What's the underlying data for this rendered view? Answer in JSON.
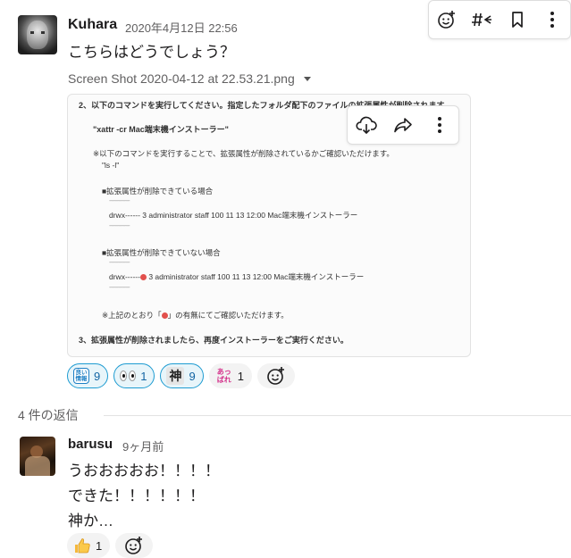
{
  "message": {
    "author": "Kuhara",
    "timestamp": "2020年4月12日 22:56",
    "text": "こちらはどうでしょう？",
    "file_name": "Screen Shot 2020-04-12 at 22.53.21.png",
    "attachment": {
      "step2": "2、以下のコマンドを実行してください。指定したフォルダ配下のファイルの拡張属性が削除されます。",
      "command": "\"xattr -cr Mac端末機インストーラー\"",
      "note": "※以下のコマンドを実行することで、拡張属性が削除されているかご確認いただけます。",
      "ls_cmd": "\"ls -l\"",
      "case_removed": "■拡張属性が削除できている場合",
      "dashes": "-----------------",
      "line_removed": "drwx------ 3 administrator staff 100 11 13 12:00 Mac端末機インストーラー",
      "case_not_removed": "■拡張属性が削除できていない場合",
      "line_not_removed_prefix": "drwx------",
      "line_not_removed_suffix": "3 administrator staff 100 11 13 12:00 Mac端末機インストーラー",
      "confirm_prefix": "※上記のとおり「",
      "confirm_suffix": "」の有無にてご確認いただけます。",
      "step3": "3、拡張属性が削除されましたら、再度インストーラーをご実行ください。"
    },
    "reactions": [
      {
        "emoji": "good-iine",
        "emoji_text": "良い情報",
        "count": "9",
        "selected": true
      },
      {
        "emoji": "eyes",
        "count": "1",
        "selected": true
      },
      {
        "emoji": "kami",
        "emoji_text": "神",
        "count": "9",
        "selected": true
      },
      {
        "emoji": "appare",
        "emoji_text": "あっぱれ",
        "count": "1",
        "selected": false
      }
    ]
  },
  "replies_label": "4 件の返信",
  "reply": {
    "author": "barusu",
    "timestamp": "9ヶ月前",
    "lines": [
      "うおおおおお！！！！",
      "できた！！！！！！",
      "神か…"
    ],
    "reactions": [
      {
        "emoji": "thumbs-up",
        "count": "1"
      }
    ]
  },
  "icons": {
    "add_reaction": "add-reaction-icon",
    "reply_thread": "reply-thread-icon",
    "bookmark": "bookmark-icon",
    "more": "more-icon",
    "download": "download-icon",
    "share": "share-icon"
  },
  "colors": {
    "selected_reaction_bg": "#e8f5fa",
    "selected_reaction_border": "#1d9bd1",
    "link_blue": "#1264a3"
  }
}
